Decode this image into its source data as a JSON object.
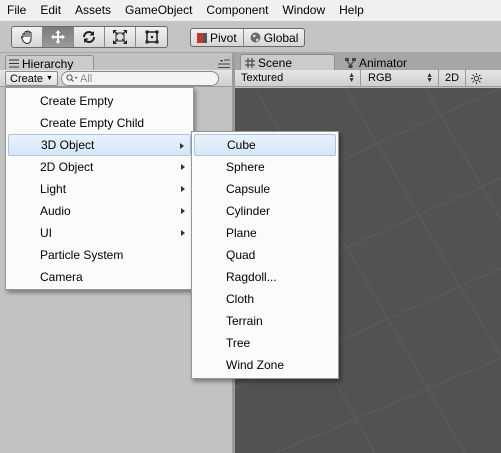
{
  "menubar": [
    "File",
    "Edit",
    "Assets",
    "GameObject",
    "Component",
    "Window",
    "Help"
  ],
  "toolbar": {
    "tools": [
      {
        "name": "hand-tool",
        "icon": "hand-icon",
        "active": false
      },
      {
        "name": "move-tool",
        "icon": "move-icon",
        "active": true
      },
      {
        "name": "rotate-tool",
        "icon": "rotate-icon",
        "active": false
      },
      {
        "name": "scale-tool",
        "icon": "scale-icon",
        "active": false
      },
      {
        "name": "rect-tool",
        "icon": "rect-icon",
        "active": false
      }
    ],
    "pivot_label": "Pivot",
    "global_label": "Global"
  },
  "hierarchy": {
    "tab_label": "Hierarchy",
    "create_label": "Create",
    "search_placeholder": "All"
  },
  "scene": {
    "tab_label": "Scene",
    "animator_label": "Animator",
    "shading_mode": "Textured",
    "render_mode": "RGB",
    "mode_2d": "2D"
  },
  "create_menu": {
    "items": [
      {
        "label": "Create Empty",
        "submenu": false
      },
      {
        "label": "Create Empty Child",
        "submenu": false
      },
      {
        "label": "3D Object",
        "submenu": true
      },
      {
        "label": "2D Object",
        "submenu": true
      },
      {
        "label": "Light",
        "submenu": true
      },
      {
        "label": "Audio",
        "submenu": true
      },
      {
        "label": "UI",
        "submenu": true
      },
      {
        "label": "Particle System",
        "submenu": false
      },
      {
        "label": "Camera",
        "submenu": false
      }
    ],
    "highlighted": "3D Object"
  },
  "submenu_3d": {
    "items": [
      "Cube",
      "Sphere",
      "Capsule",
      "Cylinder",
      "Plane",
      "Quad",
      "Ragdoll...",
      "Cloth",
      "Terrain",
      "Tree",
      "Wind Zone"
    ],
    "highlighted": "Cube"
  },
  "colors": {
    "menu_highlight": "#d6e6f8",
    "scene_background": "#525252",
    "panel_background": "#c2c2c2"
  }
}
